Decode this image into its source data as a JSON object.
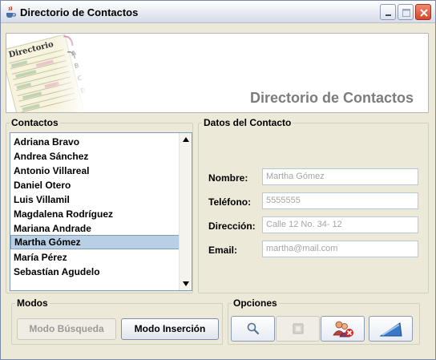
{
  "window": {
    "title": "Directorio de Contactos",
    "icons": {
      "app": "java-cup-icon",
      "minimize": "minimize-icon",
      "maximize": "maximize-icon",
      "close": "close-icon"
    }
  },
  "banner": {
    "title": "Directorio de Contactos",
    "art_caption": "Directorio",
    "art_tabs": [
      "A",
      "B",
      "C",
      "D"
    ]
  },
  "contacts": {
    "legend": "Contactos",
    "items": [
      "Adriana Bravo",
      "Andrea Sánchez",
      "Antonio Villareal",
      "Daniel Otero",
      "Luis Villamil",
      "Magdalena Rodríguez",
      "Mariana Andrade",
      "Martha Gómez",
      "María Pérez",
      "Sebastían Agudelo"
    ],
    "selected": "Martha Gómez"
  },
  "details": {
    "legend": "Datos del Contacto",
    "name_label": "Nombre:",
    "name_value": "Martha Gómez",
    "phone_label": "Teléfono:",
    "phone_value": "5555555",
    "address_label": "Dirección:",
    "address_value": "Calle 12 No. 34- 12",
    "email_label": "Email:",
    "email_value": "martha@mail.com"
  },
  "modes": {
    "legend": "Modos",
    "search_mode_label": "Modo Búsqueda",
    "insert_mode_label": "Modo Inserción"
  },
  "options": {
    "legend": "Opciones",
    "icons": [
      "search-icon",
      "save-icon",
      "delete-contact-icon",
      "exit-icon"
    ]
  },
  "colors": {
    "window_bg": "#ECE9D8",
    "selection": "#B8CFE5",
    "banner_title": "#7C7C7C",
    "field_text": "#A5A5A5"
  }
}
